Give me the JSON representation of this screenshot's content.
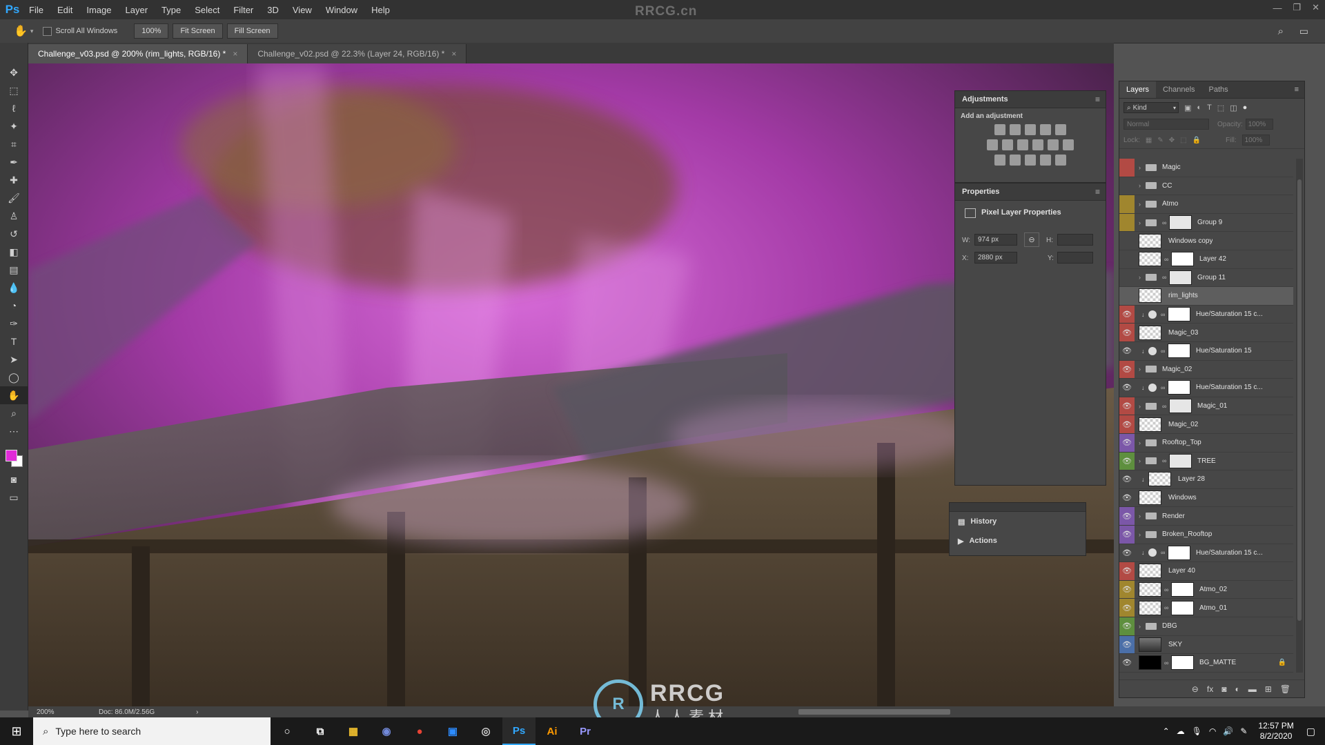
{
  "app": {
    "logo": "Ps",
    "watermark": "RRCG.cn",
    "brand_color": "#31a8ff"
  },
  "menu": [
    "File",
    "Edit",
    "Image",
    "Layer",
    "Type",
    "Select",
    "Filter",
    "3D",
    "View",
    "Window",
    "Help"
  ],
  "options_bar": {
    "scroll_all": "Scroll All Windows",
    "zoom": "100%",
    "fit_screen": "Fit Screen",
    "fill_screen": "Fill Screen"
  },
  "tabs": [
    {
      "label": "Challenge_v03.psd @ 200% (rim_lights, RGB/16) *",
      "active": true
    },
    {
      "label": "Challenge_v02.psd @ 22.3% (Layer 24, RGB/16) *",
      "active": false
    }
  ],
  "status": {
    "zoom": "200%",
    "doc": "Doc: 86.0M/2.56G"
  },
  "adjustments": {
    "title": "Adjustments",
    "subtitle": "Add an adjustment"
  },
  "properties": {
    "title": "Properties",
    "heading": "Pixel Layer Properties",
    "w_label": "W:",
    "w_value": "974 px",
    "h_label": "H:",
    "x_label": "X:",
    "x_value": "2880 px",
    "y_label": "Y:"
  },
  "history": {
    "history_label": "History",
    "actions_label": "Actions"
  },
  "layers_panel": {
    "tabs": [
      "Layers",
      "Channels",
      "Paths"
    ],
    "kind": "Kind",
    "blend": "Normal",
    "opacity_label": "Opacity:",
    "opacity": "100%",
    "lock_label": "Lock:",
    "fill_label": "Fill:",
    "fill": "100%"
  },
  "layers": [
    {
      "name": "Magic",
      "type": "group",
      "color": "#b24a44",
      "visible": false
    },
    {
      "name": "CC",
      "type": "group",
      "color": "",
      "visible": false
    },
    {
      "name": "Atmo",
      "type": "group",
      "color": "#a0862e",
      "visible": false
    },
    {
      "name": "Group 9",
      "type": "group-mask",
      "color": "#a0862e",
      "visible": false
    },
    {
      "name": "Windows copy",
      "type": "pixel",
      "color": "",
      "visible": false
    },
    {
      "name": "Layer 42",
      "type": "pixel-mask",
      "color": "",
      "visible": false
    },
    {
      "name": "Group 11",
      "type": "group-mask",
      "color": "",
      "visible": false
    },
    {
      "name": "rim_lights",
      "type": "pixel",
      "color": "",
      "visible": false,
      "selected": true
    },
    {
      "name": "Hue/Saturation 15 c...",
      "type": "adjustment",
      "color": "#b24a44",
      "visible": true
    },
    {
      "name": "Magic_03",
      "type": "pixel",
      "color": "#b24a44",
      "visible": true
    },
    {
      "name": "Hue/Saturation 15",
      "type": "adjustment",
      "color": "",
      "visible": true
    },
    {
      "name": "Magic_02",
      "type": "group",
      "color": "#b24a44",
      "visible": true
    },
    {
      "name": "Hue/Saturation 15 c...",
      "type": "adjustment",
      "color": "",
      "visible": true
    },
    {
      "name": "Magic_01",
      "type": "group-mask",
      "color": "#b24a44",
      "visible": true
    },
    {
      "name": "Magic_02",
      "type": "pixel",
      "color": "#b24a44",
      "visible": true
    },
    {
      "name": "Rooftop_Top",
      "type": "group",
      "color": "#7b57a8",
      "visible": true
    },
    {
      "name": "TREE",
      "type": "group-mask",
      "color": "#5e8f3e",
      "visible": true
    },
    {
      "name": "Layer 28",
      "type": "pixel-clip",
      "color": "",
      "visible": true
    },
    {
      "name": "Windows",
      "type": "pixel",
      "color": "",
      "visible": true
    },
    {
      "name": "Render",
      "type": "group",
      "color": "#7b57a8",
      "visible": true
    },
    {
      "name": "Broken_Rooftop",
      "type": "group",
      "color": "#7b57a8",
      "visible": true
    },
    {
      "name": "Hue/Saturation 15 c...",
      "type": "adjustment",
      "color": "",
      "visible": true
    },
    {
      "name": "Layer 40",
      "type": "pixel",
      "color": "#b24a44",
      "visible": true
    },
    {
      "name": "Atmo_02",
      "type": "pixel-mask",
      "color": "#a0862e",
      "visible": true
    },
    {
      "name": "Atmo_01",
      "type": "pixel-mask",
      "color": "#a0862e",
      "visible": true
    },
    {
      "name": "DBG",
      "type": "group",
      "color": "#5e8f3e",
      "visible": true
    },
    {
      "name": "SKY",
      "type": "pixel",
      "color": "#4b6fa8",
      "visible": true
    },
    {
      "name": "BG_MATTE",
      "type": "pixel-mask",
      "color": "",
      "visible": true,
      "locked": true
    }
  ],
  "taskbar": {
    "search_placeholder": "Type here to search",
    "apps": [
      {
        "label": "○",
        "color": "#ffffff"
      },
      {
        "label": "⧉",
        "color": "#ffffff"
      },
      {
        "label": "▦",
        "color": "#f2c12e"
      },
      {
        "label": "◉",
        "color": "#7289da"
      },
      {
        "label": "●",
        "color": "#e84335"
      },
      {
        "label": "▣",
        "color": "#2d8cff"
      },
      {
        "label": "◎",
        "color": "#cfcfcf"
      },
      {
        "label": "Ps",
        "color": "#31a8ff"
      },
      {
        "label": "Ai",
        "color": "#ff9a00"
      },
      {
        "label": "Pr",
        "color": "#9999ff"
      }
    ],
    "time": "12:57 PM",
    "date": "8/2/2020"
  },
  "watermark_bottom": {
    "latin": "RRCG",
    "cjk": "人人素材"
  }
}
